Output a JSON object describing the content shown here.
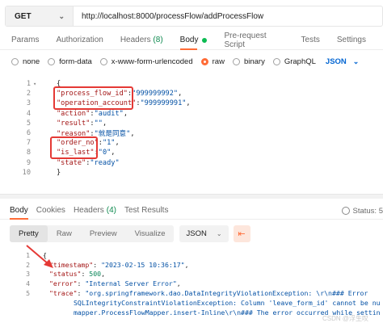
{
  "request": {
    "method": "GET",
    "url": "http://localhost:8000/processFlow/addProcessFlow",
    "tabs": [
      {
        "label": "Params"
      },
      {
        "label": "Authorization"
      },
      {
        "label": "Headers",
        "count": "(8)"
      },
      {
        "label": "Body",
        "active": true
      },
      {
        "label": "Pre-request Script"
      },
      {
        "label": "Tests"
      },
      {
        "label": "Settings"
      }
    ],
    "body_types": [
      "none",
      "form-data",
      "x-www-form-urlencoded",
      "raw",
      "binary",
      "GraphQL"
    ],
    "selected_body_type": "raw",
    "language": "JSON",
    "code_lines": [
      {
        "n": "1",
        "text": "{"
      },
      {
        "n": "2",
        "key": "\"process_flow_id\"",
        "sep": ":",
        "val": "\"999999992\"",
        "end": ","
      },
      {
        "n": "3",
        "key": "\"operation_account\"",
        "sep": ":",
        "val": "\"999999991\"",
        "end": ","
      },
      {
        "n": "4",
        "key": "\"action\"",
        "sep": ":",
        "val": "\"audit\"",
        "end": ","
      },
      {
        "n": "5",
        "key": "\"result\"",
        "sep": ":",
        "val": "\"\"",
        "end": ","
      },
      {
        "n": "6",
        "key": "\"reason\"",
        "sep": ":",
        "val": "\"就是同意\"",
        "end": ","
      },
      {
        "n": "7",
        "key": "\"order_no\"",
        "sep": ":",
        "val": "\"1\"",
        "end": ","
      },
      {
        "n": "8",
        "key": "\"is_last\"",
        "sep": ":",
        "val": "\"0\"",
        "end": ","
      },
      {
        "n": "9",
        "key": "\"state\"",
        "sep": ":",
        "val": "\"ready\"",
        "end": ""
      },
      {
        "n": "10",
        "text": "}"
      }
    ]
  },
  "response": {
    "tabs": [
      {
        "label": "Body",
        "active": true
      },
      {
        "label": "Cookies"
      },
      {
        "label": "Headers",
        "count": "(4)"
      },
      {
        "label": "Test Results"
      }
    ],
    "status_label": "Status: 5",
    "views": [
      "Pretty",
      "Raw",
      "Preview",
      "Visualize"
    ],
    "active_view": "Pretty",
    "format": "JSON",
    "lines": [
      {
        "n": "1",
        "text": "{"
      },
      {
        "n": "2",
        "key": "\"timestamp\"",
        "sep": ": ",
        "val": "\"2023-02-15 10:36:17\"",
        "end": ","
      },
      {
        "n": "3",
        "key": "\"status\"",
        "sep": ": ",
        "num": "500",
        "end": ","
      },
      {
        "n": "4",
        "key": "\"error\"",
        "sep": ": ",
        "val": "\"Internal Server Error\"",
        "end": ","
      },
      {
        "n": "5",
        "key": "\"trace\"",
        "sep": ": ",
        "val": "\"org.springframework.dao.DataIntegrityViolationException: \\r\\n### Error",
        "end": ""
      },
      {
        "n": "",
        "cont": "SQLIntegrityConstraintViolationException: Column 'leave_form_id' cannot be nu"
      },
      {
        "n": "",
        "cont": "mapper.ProcessFlowMapper.insert-Inline\\r\\n### The error occurred while settin"
      }
    ]
  },
  "watermark": "CSDN @浮生叹"
}
